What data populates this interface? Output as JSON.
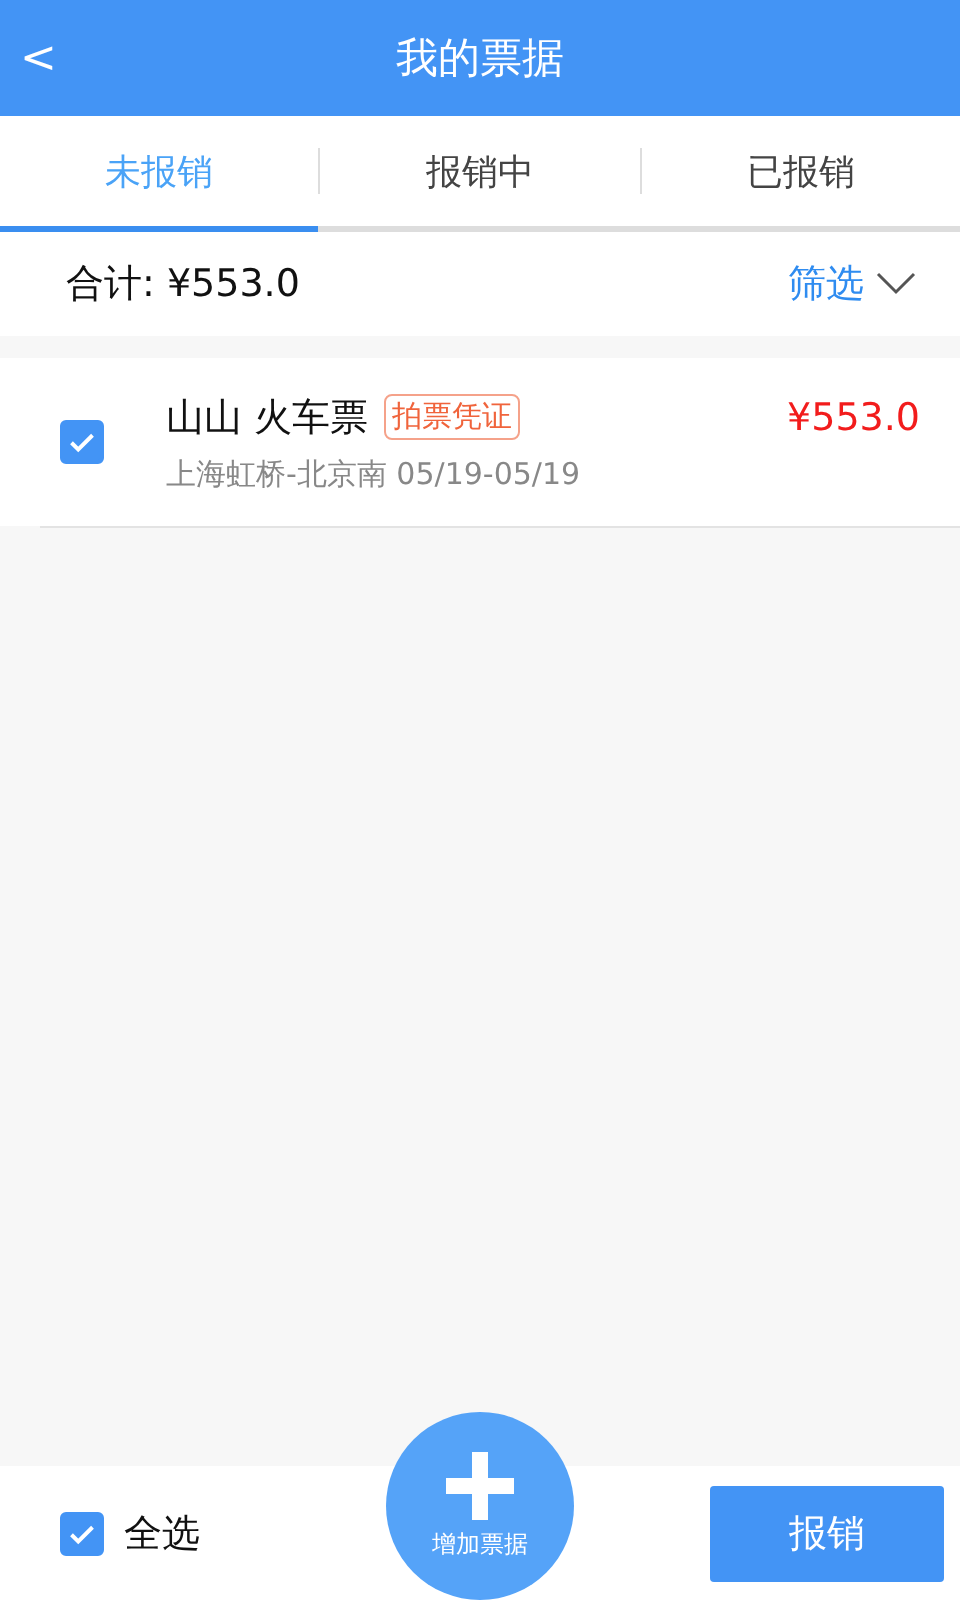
{
  "header": {
    "back": "<",
    "title": "我的票据"
  },
  "tabs": [
    {
      "label": "未报销",
      "selected": true
    },
    {
      "label": "报销中",
      "selected": false
    },
    {
      "label": "已报销",
      "selected": false
    }
  ],
  "summary": {
    "total": "合计: ¥553.0",
    "filter": "筛选"
  },
  "tickets": [
    {
      "name": "山山 火车票",
      "tag": "拍票凭证",
      "amount": "¥553.0",
      "route": "上海虹桥-北京南 05/19-05/19",
      "checked": true
    }
  ],
  "footer": {
    "select_all": {
      "label": "全选",
      "checked": true
    },
    "add_button": "增加票据",
    "submit": "报销"
  }
}
